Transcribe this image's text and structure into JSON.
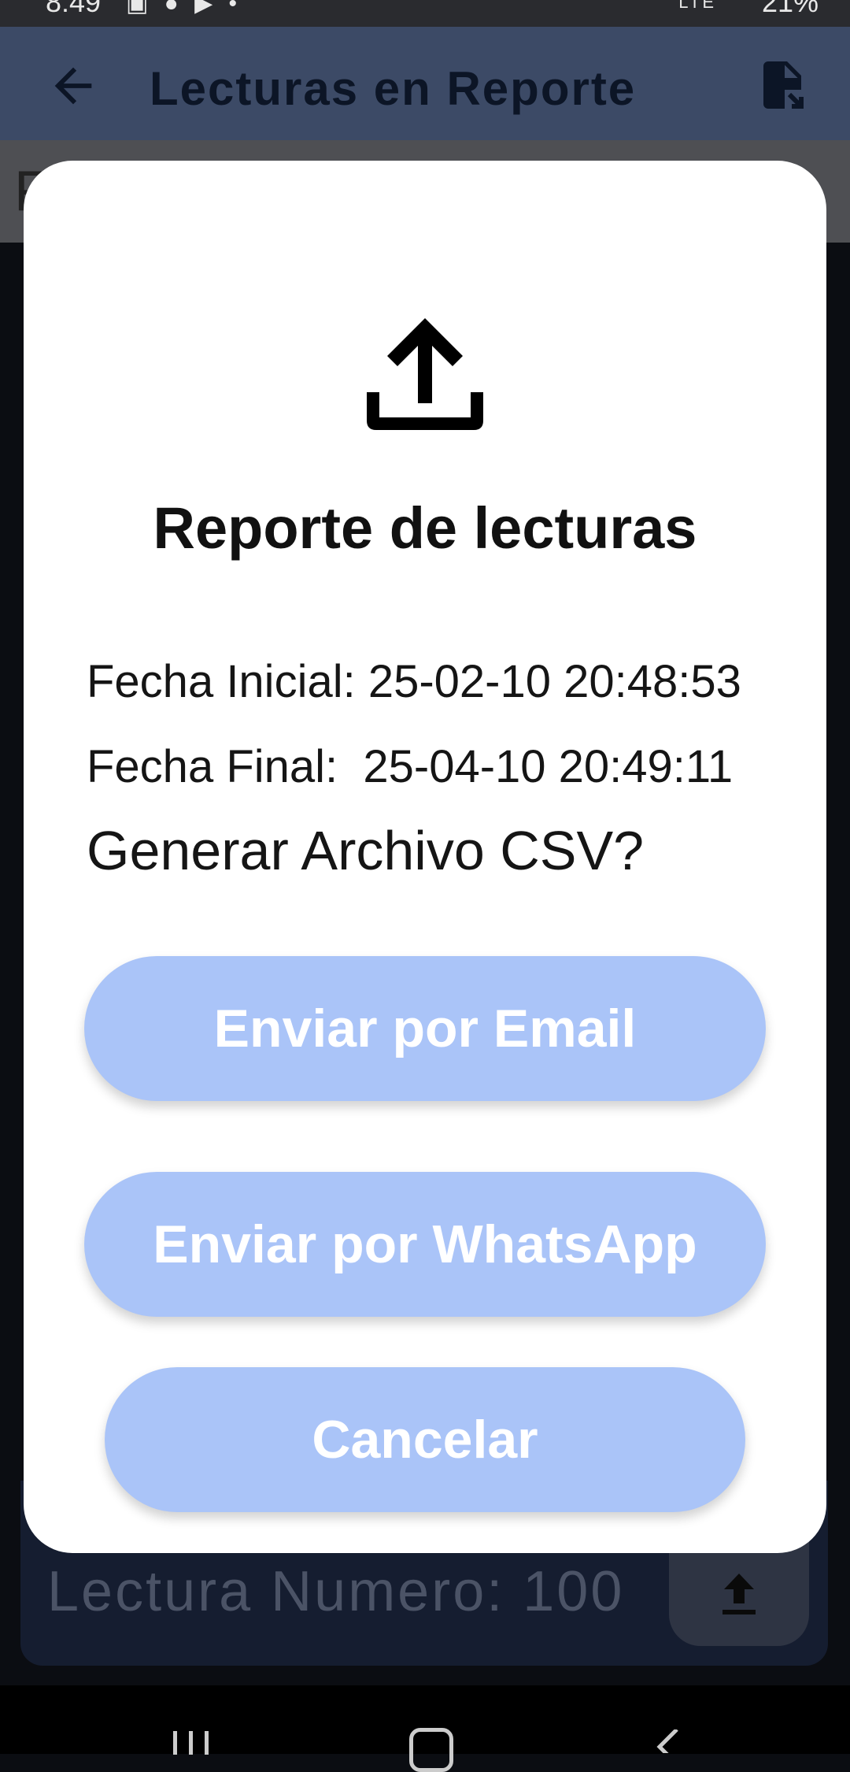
{
  "status_bar": {
    "time": "8:49",
    "signal": "LTE",
    "battery": "21%"
  },
  "app_bar": {
    "title": "Lecturas en Reporte"
  },
  "background": {
    "filter_letter": "F",
    "card_label": "Lectura Numero: 100"
  },
  "dialog": {
    "title": "Reporte de lecturas",
    "fecha_inicial": "Fecha Inicial: 25-02-10 20:48:53",
    "fecha_final": "Fecha Final:  25-04-10 20:49:11",
    "question": "Generar Archivo CSV?",
    "email_button": "Enviar por Email",
    "whatsapp_button": "Enviar por WhatsApp",
    "cancel_button": "Cancelar"
  },
  "colors": {
    "app_bar": "#3c4a66",
    "dialog_bg": "#ffffff",
    "button_bg": "#aac4f8",
    "button_text": "#ffffff"
  },
  "icons": [
    "back-arrow-icon",
    "file-export-icon",
    "upload-icon",
    "recent-apps-icon",
    "home-icon",
    "nav-back-icon"
  ]
}
